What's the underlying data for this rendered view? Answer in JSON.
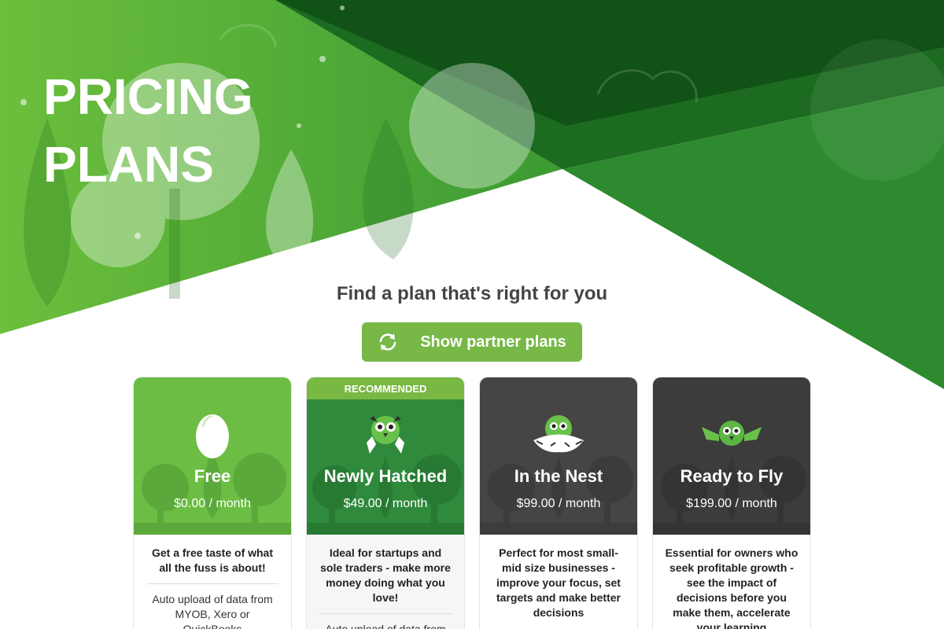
{
  "hero": {
    "title_line1": "PRICING",
    "title_line2": "PLANS"
  },
  "subtitle": "Find a plan that's right for you",
  "partner_button": {
    "label": "Show partner plans",
    "icon": "refresh-icon"
  },
  "colors": {
    "brand_green": "#77b847",
    "dark_green": "#2a7a2a",
    "card_dark": "#3d3d3d",
    "text_dark": "#444444"
  },
  "plans": [
    {
      "name": "Free",
      "price": "$0.00 / month",
      "icon": "egg-icon",
      "badge": "",
      "description": "Get a free taste of what all the fuss is about!",
      "feature": "Auto upload of data from MYOB, Xero or QuickBooks"
    },
    {
      "name": "Newly Hatched",
      "price": "$49.00 / month",
      "icon": "hatched-chick-icon",
      "badge": "RECOMMENDED",
      "description": "Ideal for startups and sole traders - make more money doing what you love!",
      "feature": "Auto upload of data from"
    },
    {
      "name": "In the Nest",
      "price": "$99.00 / month",
      "icon": "nest-chick-icon",
      "badge": "",
      "description": "Perfect for most small-mid size businesses - improve your focus, set targets and make better decisions",
      "feature": ""
    },
    {
      "name": "Ready to Fly",
      "price": "$199.00 / month",
      "icon": "flying-bird-icon",
      "badge": "",
      "description": "Essential for owners who seek profitable growth - see the impact of decisions before you make them, accelerate your learning",
      "feature": ""
    }
  ]
}
